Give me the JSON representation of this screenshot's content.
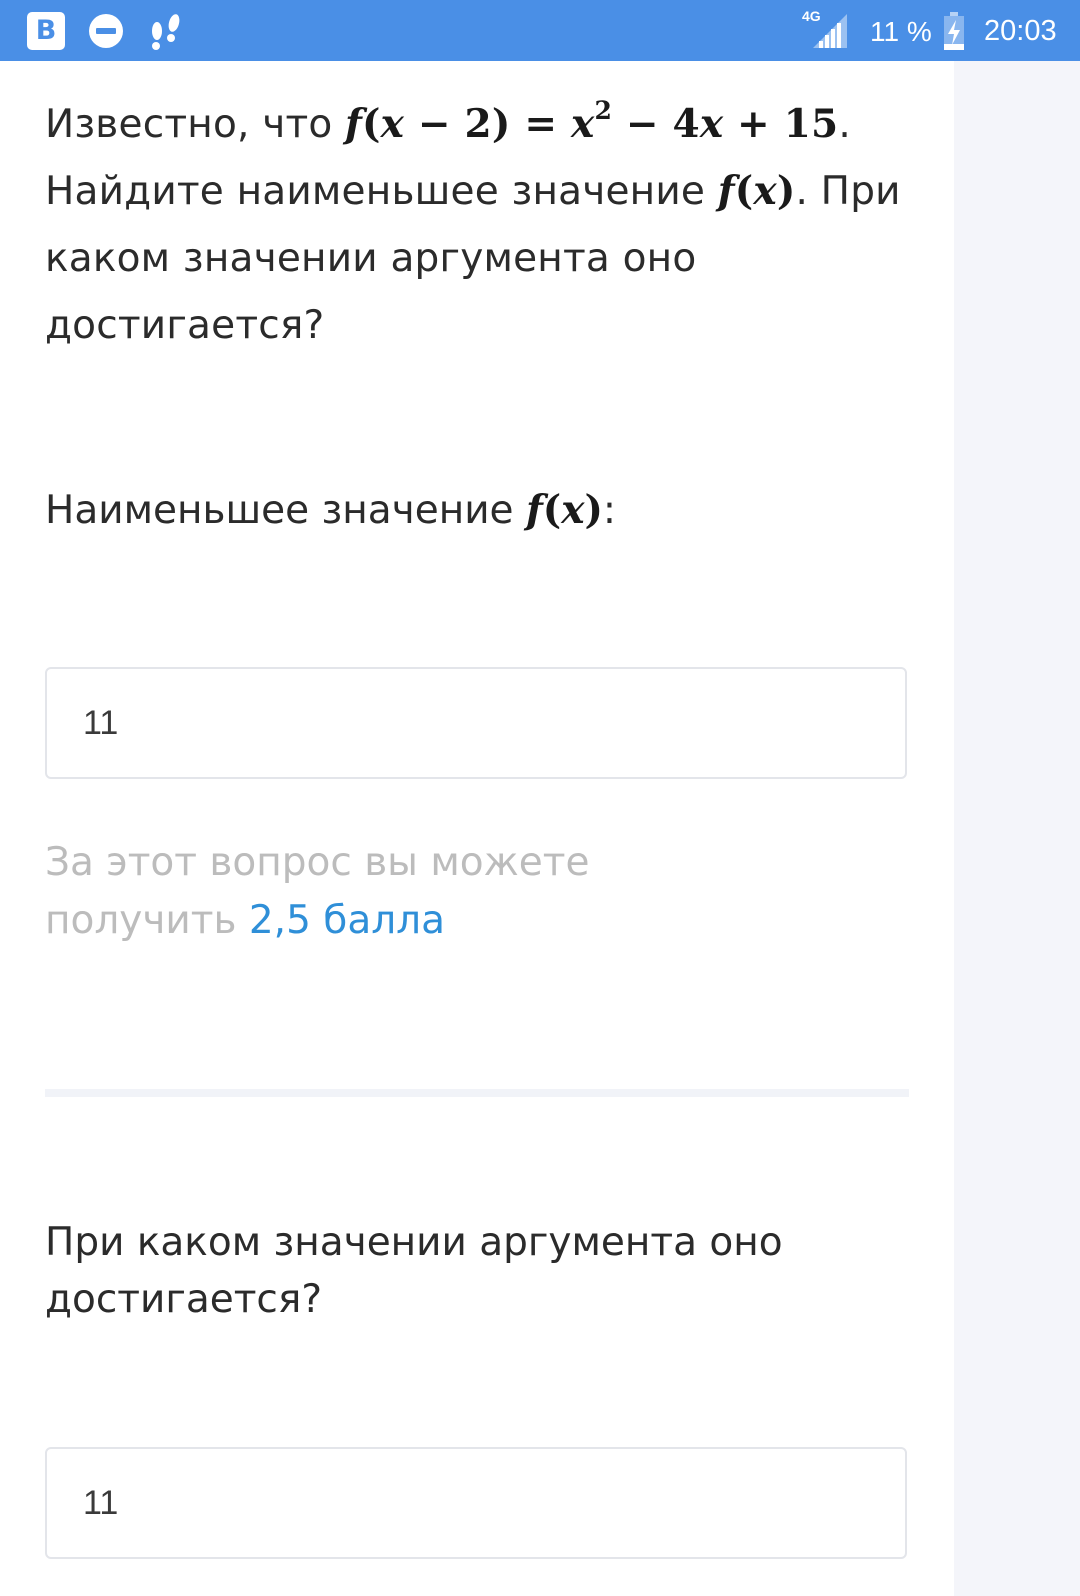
{
  "status_bar": {
    "left_icons": [
      "vk-icon",
      "do-not-disturb-icon",
      "footprints-icon"
    ],
    "vk_letter": "В",
    "network_type": "4G",
    "battery_percent": "11 %",
    "time": "20:03",
    "background_color": "#4a8fe6"
  },
  "question": {
    "prefix": "Известно, что ",
    "equation": {
      "lhs_f": "f",
      "lhs_open": "(",
      "lhs_x": "x",
      "lhs_rest": " − 2) = ",
      "x_var": "x",
      "exponent": "2",
      "minus_term": " − 4",
      "x_var2": "x",
      "tail": " + 15"
    },
    "after_equation": ". Найдите наименьшее значение ",
    "fx": {
      "f": "f",
      "open": "(",
      "x": "x",
      "close": ")"
    },
    "suffix": ". При каком значении аргумента оно достигается?"
  },
  "part1": {
    "label_prefix": "Наименьшее значение ",
    "fx": {
      "f": "f",
      "open": "(",
      "x": "x",
      "close": ")"
    },
    "label_suffix": ":",
    "answer_value": "11"
  },
  "points_note": {
    "text": "За этот вопрос вы можете получить ",
    "points": "2,5 балла",
    "accent_color": "#2f8fd8"
  },
  "part2": {
    "label": "При каком значении аргумента оно достигается?",
    "answer_value": "11"
  }
}
